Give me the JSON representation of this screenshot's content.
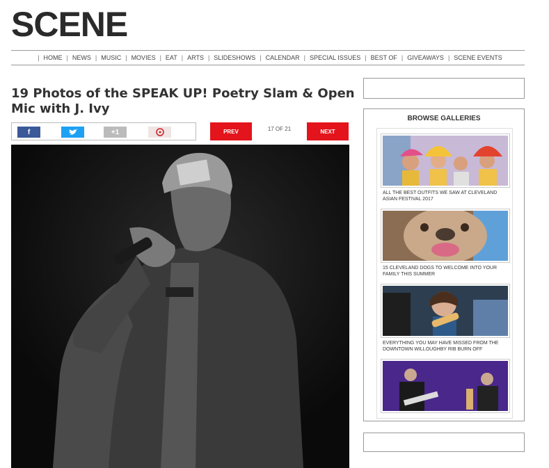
{
  "site": {
    "logo": "SCENE"
  },
  "nav": [
    "HOME",
    "NEWS",
    "MUSIC",
    "MOVIES",
    "EAT",
    "ARTS",
    "SLIDESHOWS",
    "CALENDAR",
    "SPECIAL ISSUES",
    "BEST OF",
    "GIVEAWAYS",
    "SCENE EVENTS"
  ],
  "article": {
    "title": "19 Photos of the SPEAK UP! Poetry Slam & Open Mic with J. Ivy"
  },
  "share": {
    "facebook": "f",
    "twitter": "t",
    "googleplus": "+1",
    "pinterest": "P"
  },
  "pager": {
    "prev": "PREV",
    "next": "NEXT",
    "counter": "17 OF 21"
  },
  "sidebar": {
    "title": "BROWSE GALLERIES",
    "items": [
      {
        "caption": "ALL THE BEST OUTFITS WE SAW AT CLEVELAND ASIAN FESTIVAL 2017"
      },
      {
        "caption": "15 CLEVELAND DOGS TO WELCOME INTO YOUR FAMILY THIS SUMMER"
      },
      {
        "caption": "EVERYTHING YOU MAY HAVE MISSED FROM THE DOWNTOWN WILLOUGHBY RIB BURN OFF"
      },
      {
        "caption": ""
      }
    ]
  },
  "colors": {
    "accent_red": "#e3141c",
    "facebook": "#3b5998",
    "twitter": "#1da1f2"
  }
}
